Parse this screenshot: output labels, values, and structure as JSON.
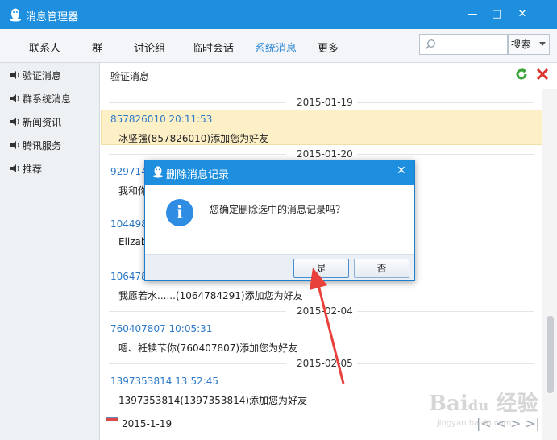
{
  "window": {
    "title": "消息管理器",
    "controls": [
      "minimize",
      "maximize",
      "close"
    ]
  },
  "tabs": [
    {
      "label": "联系人",
      "active": false
    },
    {
      "label": "群",
      "active": false
    },
    {
      "label": "讨论组",
      "active": false
    },
    {
      "label": "临时会话",
      "active": false
    },
    {
      "label": "系统消息",
      "active": true
    },
    {
      "label": "更多",
      "active": false
    }
  ],
  "search": {
    "placeholder": "",
    "button_label": "搜索"
  },
  "sidebar": {
    "items": [
      {
        "label": "验证消息",
        "active": true
      },
      {
        "label": "群系统消息",
        "active": false
      },
      {
        "label": "新闻资讯",
        "active": false
      },
      {
        "label": "腾讯服务",
        "active": false
      },
      {
        "label": "推荐",
        "active": false
      }
    ]
  },
  "content": {
    "title": "验证消息",
    "groups": [
      {
        "date": "2015-01-19",
        "messages": [
          {
            "header": "857826010 20:11:53",
            "body": "冰坚强(857826010)添加您为好友",
            "selected": true
          }
        ]
      },
      {
        "date": "2015-01-20",
        "messages": [
          {
            "header": "929714",
            "body": "我和你"
          },
          {
            "header": "104498",
            "body": "Elizab"
          },
          {
            "header": "106478",
            "body": "我愿若水......(1064784291)添加您为好友"
          }
        ]
      },
      {
        "date": "2015-02-04",
        "messages": [
          {
            "header": "760407807 10:05:31",
            "body": "嗯、衽犊芐你(760407807)添加您为好友"
          }
        ]
      },
      {
        "date": "2015-02-05",
        "messages": [
          {
            "header": "1397353814 13:52:45",
            "body": "1397353814(1397353814)添加您为好友"
          }
        ]
      }
    ]
  },
  "bottom": {
    "date": "2015-1-19"
  },
  "dialog": {
    "title": "删除消息记录",
    "message": "您确定删除选中的消息记录吗？",
    "confirm_label": "是",
    "cancel_label": "否"
  },
  "watermark": {
    "text": "Bai du 经验",
    "sub": "jingyan.baidu.com"
  },
  "colors": {
    "titlebar": "#1d8fde",
    "active_tab": "#2a86d6",
    "link": "#2a78c6",
    "highlight": "#fdefc6",
    "annotation_arrow": "#e8403a"
  }
}
